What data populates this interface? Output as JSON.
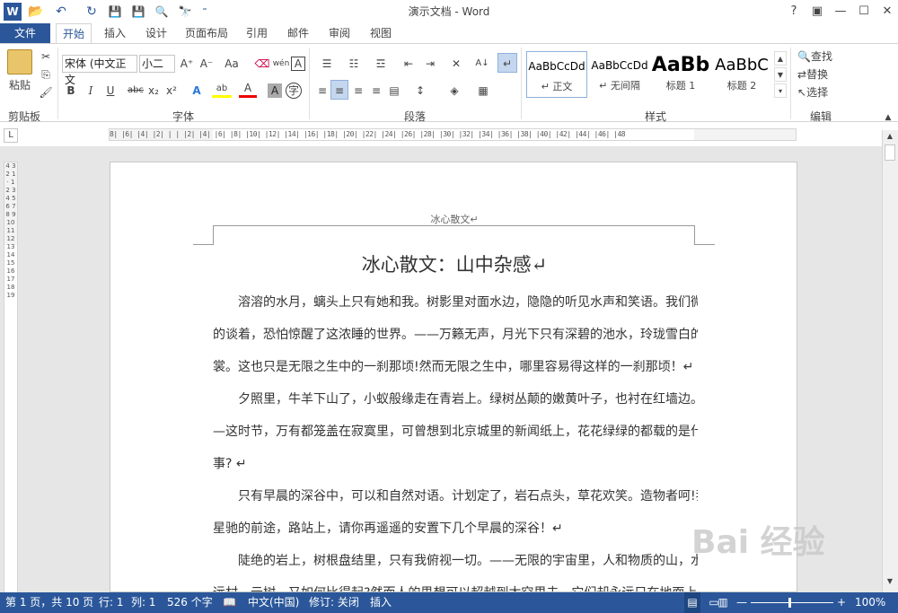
{
  "window": {
    "title": "演示文档 - Word",
    "help": "?",
    "restore_ribbon": "▣",
    "minimize": "—",
    "maximize": "☐",
    "close": "✕"
  },
  "qat": {
    "word_icon": "W",
    "open": "📂",
    "undo": "↶",
    "redo": "↻",
    "save": "💾",
    "save_as": "💾",
    "preview": "🔍",
    "find": "🔭",
    "more": "⁼"
  },
  "tabs": [
    "文件",
    "开始",
    "插入",
    "设计",
    "页面布局",
    "引用",
    "邮件",
    "审阅",
    "视图"
  ],
  "ribbon": {
    "clipboard": {
      "label": "剪贴板",
      "paste": "粘贴",
      "cut": "✂",
      "copy": "⎘",
      "format_painter": "🖌"
    },
    "font": {
      "label": "字体",
      "font_name": "宋体 (中文正文",
      "font_size": "小二",
      "grow": "A⁺",
      "shrink": "A⁻",
      "case": "Aa",
      "clear": "⌫",
      "pinyin": "wén",
      "border": "A",
      "bold": "B",
      "italic": "I",
      "underline": "U",
      "strike": "abc",
      "sub": "x₂",
      "sup": "x²",
      "effects": "A",
      "highlight": "ab",
      "color": "A",
      "shade": "A",
      "circle": "字"
    },
    "paragraph": {
      "label": "段落",
      "bullets": "☰",
      "numbering": "☷",
      "multilevel": "☲",
      "outdent": "⇤",
      "indent": "⇥",
      "asian": "✕",
      "sort": "A↓",
      "marks": "↵",
      "align_left": "≡",
      "center": "≡",
      "align_right": "≡",
      "justify": "≡",
      "distributed": "▤",
      "line_spacing": "↕",
      "shading": "◈",
      "borders": "▦"
    },
    "styles": {
      "label": "样式",
      "items": [
        {
          "preview": "AaBbCcDd",
          "name": "↵ 正文"
        },
        {
          "preview": "AaBbCcDd",
          "name": "↵ 无间隔"
        },
        {
          "preview": "AaBb",
          "name": "标题 1"
        },
        {
          "preview": "AaBbC",
          "name": "标题 2"
        }
      ]
    },
    "editing": {
      "label": "编辑",
      "find": "查找",
      "replace": "替换",
      "select": "选择"
    }
  },
  "ruler": {
    "marks": "8| |6| |4| |2| | | |2| |4| |6| |8| |10| |12| |14| |16| |18| |20| |22| |24| |26| |28| |30| |32| |34| |36| |38| |40| |42| |44| |46| |48"
  },
  "vruler": {
    "marks": "4 3 2 1 · 1 2 3 4 5 6 7 8 9 10 11 12 13 14 15 16 17 18 19"
  },
  "document": {
    "header": "冰心散文↵",
    "title": "冰心散文：山中杂感↵",
    "paragraphs": [
      "溶溶的水月，螭头上只有她和我。树影里对面水边，隐隐的听见水声和笑语。我们微微",
      "的谈着，恐怕惊醒了这浓睡的世界。——万籁无声，月光下只有深碧的池水，玲珑雪白的衣",
      "裳。这也只是无限之生中的一刹那顷!然而无限之生中，哪里容易得这样的一刹那顷！↵",
      "夕照里，牛羊下山了，小蚁般缘走在青岩上。绿树丛颠的嫩黄叶子，也衬在红墙边。—",
      "—这时节，万有都笼盖在寂寞里，可曾想到北京城里的新闻纸上，花花绿绿的都载的是什么",
      "事? ↵",
      "只有早晨的深谷中，可以和自然对语。计划定了，岩石点头，草花欢笑。造物者呵!我们",
      "星驰的前途，路站上，请你再遥遥的安置下几个早晨的深谷！↵",
      "陡绝的岩上，树根盘结里，只有我俯视一切。——无限的宇宙里，人和物质的山，水，",
      "远村，云树，又如何比得起?然而人的思想可以超越到太空里去，它们却永远只在地面上"
    ]
  },
  "status": {
    "page": "第 1 页，共 10 页",
    "line": "行: 1",
    "col": "列: 1",
    "words": "526 个字",
    "lang": "中文(中国)",
    "track": "修订: 关闭",
    "insert": "插入",
    "zoom": "100%",
    "zoom_level": 100
  },
  "watermark": "Bai 经验",
  "colors": {
    "accent": "#2b579a"
  }
}
